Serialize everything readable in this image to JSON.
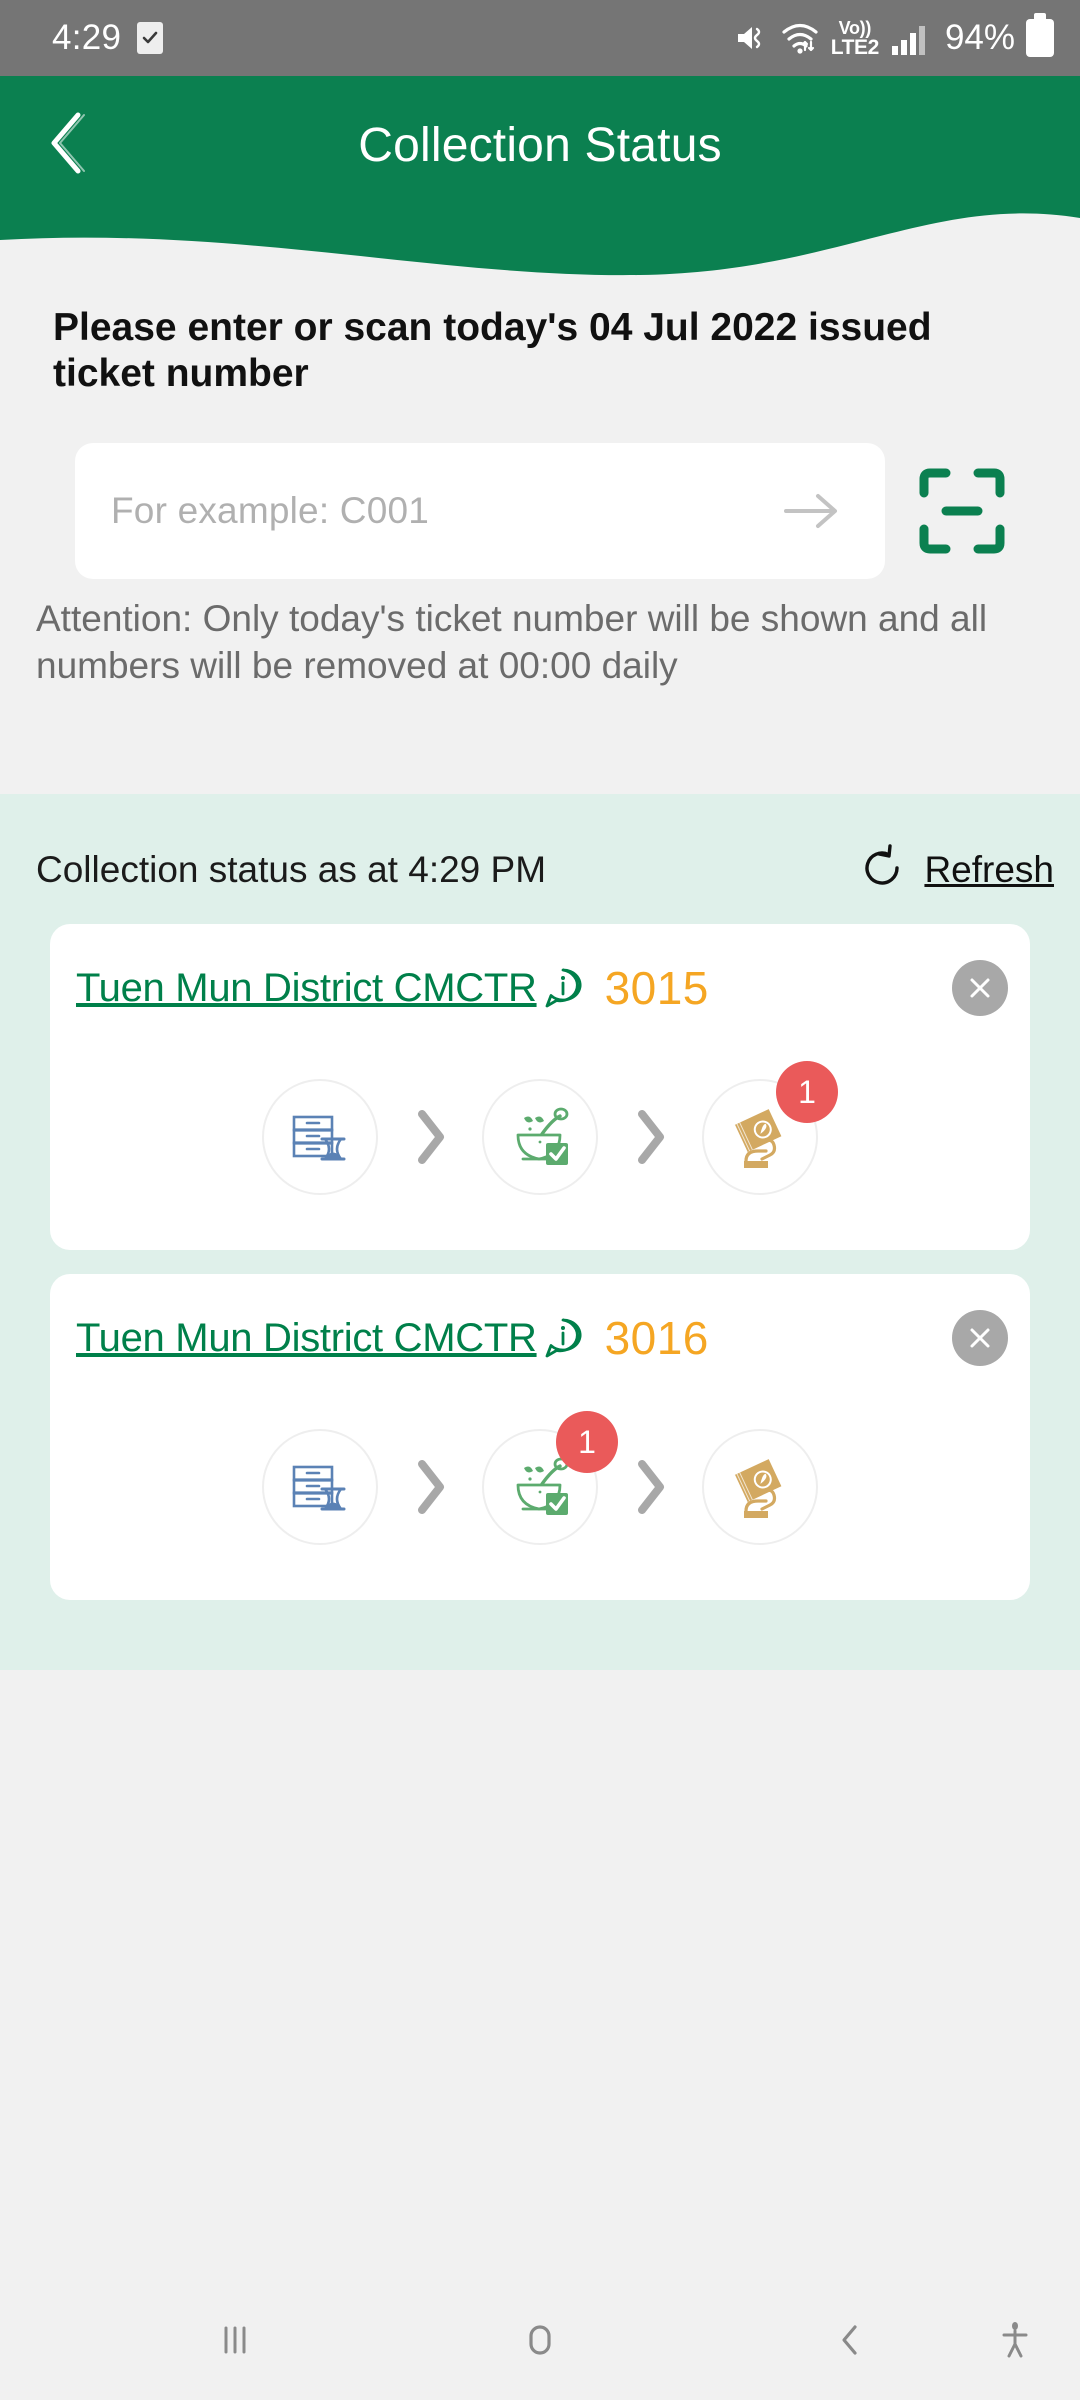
{
  "status_bar": {
    "clock": "4:29",
    "battery_percent": "94%",
    "network_label_top": "Vo))",
    "network_label_bottom": "LTE2",
    "icons": [
      "checkbox-icon",
      "mute-icon",
      "wifi-icon",
      "volte-icon",
      "signal-icon",
      "battery-icon"
    ]
  },
  "header": {
    "title": "Collection Status",
    "back_icon": "back-chevron-icon",
    "background_color": "#0b8050"
  },
  "main": {
    "instruction": "Please enter or scan today's 04 Jul 2022 issued ticket number",
    "input": {
      "value": "",
      "placeholder": "For example: C001",
      "submit_icon": "arrow-right-icon",
      "scan_icon": "scan-frame-icon"
    },
    "attention": "Attention: Only today's ticket number will be shown and all numbers will be removed at 00:00 daily"
  },
  "collection": {
    "status_label": "Collection status as at 4:29 PM",
    "refresh_label": "Refresh",
    "refresh_icon": "refresh-icon",
    "background_color": "#dff0ea",
    "cards": [
      {
        "clinic": "Tuen Mun District CMCTR",
        "info_icon": "info-bubble-icon",
        "ticket": "3015",
        "ticket_color": "#f5a623",
        "close_icon": "close-icon",
        "steps": [
          {
            "icon": "registration-drawers-hourglass-icon",
            "badge": ""
          },
          {
            "icon": "mortar-pestle-check-icon",
            "badge": ""
          },
          {
            "icon": "hand-medicine-packet-icon",
            "badge": "1"
          }
        ]
      },
      {
        "clinic": "Tuen Mun District CMCTR",
        "info_icon": "info-bubble-icon",
        "ticket": "3016",
        "ticket_color": "#f5a623",
        "close_icon": "close-icon",
        "steps": [
          {
            "icon": "registration-drawers-hourglass-icon",
            "badge": ""
          },
          {
            "icon": "mortar-pestle-check-icon",
            "badge": "1"
          },
          {
            "icon": "hand-medicine-packet-icon",
            "badge": ""
          }
        ]
      }
    ]
  },
  "navbar": {
    "recents_icon": "recents-icon",
    "home_icon": "home-icon",
    "back_icon": "back-icon",
    "accessibility_icon": "accessibility-icon"
  }
}
